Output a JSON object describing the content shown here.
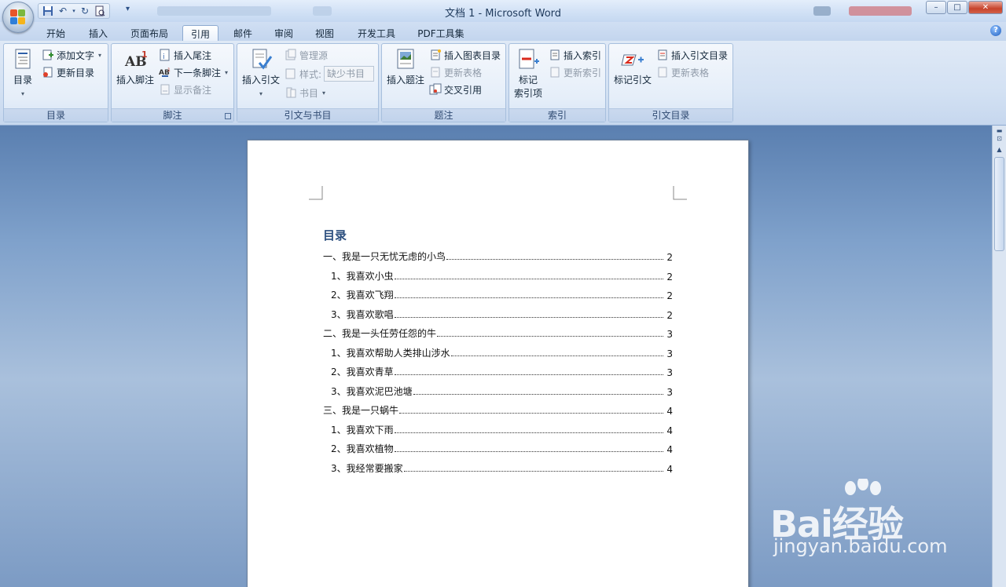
{
  "window": {
    "title": "文档 1 - Microsoft Word",
    "controls": {
      "minimize": "–",
      "maximize": "□",
      "close": "✕"
    }
  },
  "quick_access": [
    "save-icon",
    "undo-icon",
    "redo-icon",
    "print-preview-icon"
  ],
  "tabs": [
    {
      "label": "开始"
    },
    {
      "label": "插入"
    },
    {
      "label": "页面布局"
    },
    {
      "label": "引用",
      "active": true
    },
    {
      "label": "邮件"
    },
    {
      "label": "审阅"
    },
    {
      "label": "视图"
    },
    {
      "label": "开发工具"
    },
    {
      "label": "PDF工具集"
    }
  ],
  "ribbon": {
    "toc_group": {
      "label": "目录",
      "toc_button": "目录",
      "add_text": "添加文字",
      "update_toc": "更新目录"
    },
    "footnote_group": {
      "label": "脚注",
      "insert_footnote": "插入脚注",
      "insert_endnote": "插入尾注",
      "next_footnote": "下一条脚注",
      "show_notes": "显示备注"
    },
    "citation_group": {
      "label": "引文与书目",
      "insert_citation": "插入引文",
      "manage_sources": "管理源",
      "style_label": "样式:",
      "style_value": "缺少书目",
      "bibliography": "书目"
    },
    "caption_group": {
      "label": "题注",
      "insert_caption": "插入题注",
      "insert_table_of_figures": "插入图表目录",
      "update_table": "更新表格",
      "cross_reference": "交叉引用"
    },
    "index_group": {
      "label": "索引",
      "mark_entry_line1": "标记",
      "mark_entry_line2": "索引项",
      "insert_index": "插入索引",
      "update_index": "更新索引"
    },
    "toa_group": {
      "label": "引文目录",
      "mark_citation": "标记引文",
      "insert_toa": "插入引文目录",
      "update_table": "更新表格"
    }
  },
  "document": {
    "toc_title": "目录",
    "entries": [
      {
        "text": "一、我是一只无忧无虑的小鸟",
        "page": "2",
        "level": 1
      },
      {
        "text": "1、我喜欢小虫",
        "page": "2",
        "level": 2
      },
      {
        "text": "2、我喜欢飞翔",
        "page": "2",
        "level": 2
      },
      {
        "text": "3、我喜欢歌唱",
        "page": "2",
        "level": 2
      },
      {
        "text": "二、我是一头任劳任怨的牛",
        "page": "3",
        "level": 1
      },
      {
        "text": "1、我喜欢帮助人类排山涉水",
        "page": "3",
        "level": 2
      },
      {
        "text": "2、我喜欢青草",
        "page": "3",
        "level": 2
      },
      {
        "text": "3、我喜欢泥巴池塘",
        "page": "3",
        "level": 2
      },
      {
        "text": "三、我是一只蜗牛",
        "page": "4",
        "level": 1
      },
      {
        "text": "1、我喜欢下雨",
        "page": "4",
        "level": 2
      },
      {
        "text": "2、我喜欢植物",
        "page": "4",
        "level": 2
      },
      {
        "text": "3、我经常要搬家",
        "page": "4",
        "level": 2
      }
    ]
  },
  "watermark": {
    "brand": "Bai经验",
    "url": "jingyan.baidu.com"
  },
  "colors": {
    "accent": "#2b4e7e",
    "ribbon": "#dfe9f6",
    "background": "#6f8fb8"
  }
}
